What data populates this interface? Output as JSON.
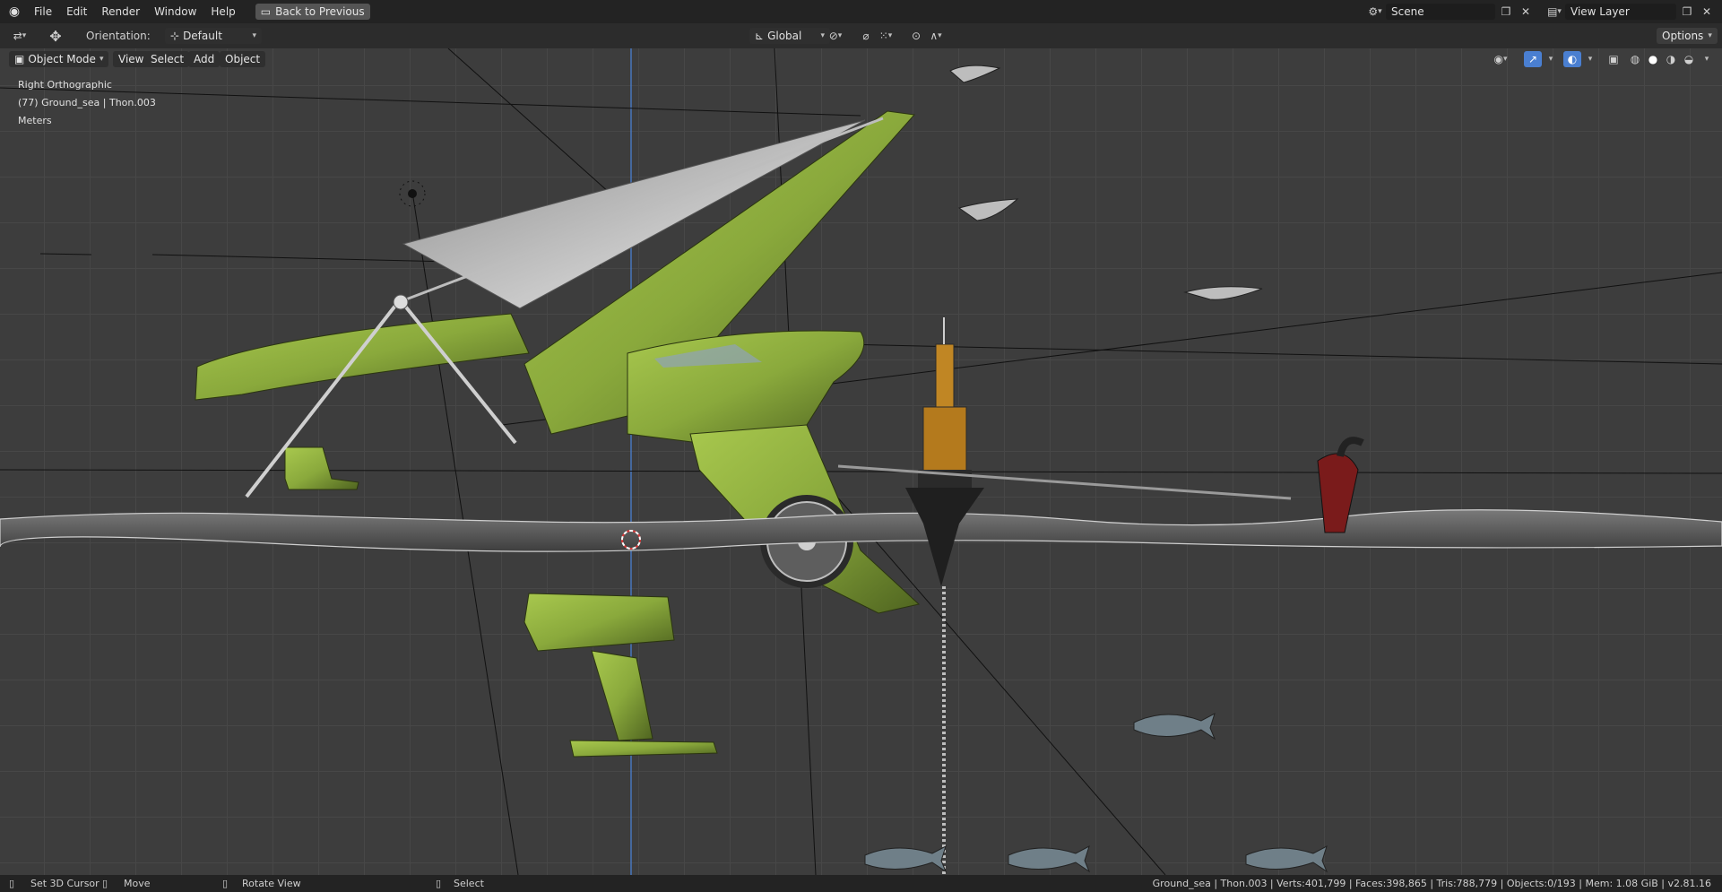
{
  "menubar": {
    "items": [
      "File",
      "Edit",
      "Render",
      "Window",
      "Help"
    ],
    "back_button": "Back to Previous",
    "scene_label": "Scene",
    "view_layer_label": "View Layer"
  },
  "tool_header": {
    "orientation_label": "Orientation:",
    "orientation_value": "Default",
    "transform_space": "Global",
    "options_label": "Options"
  },
  "viewport_header": {
    "mode": "Object Mode",
    "menus": [
      "View",
      "Select",
      "Add",
      "Object"
    ]
  },
  "viewport_info": {
    "view_name": "Right Orthographic",
    "object_info": "(77) Ground_sea | Thon.003",
    "units": "Meters"
  },
  "statusbar": {
    "left": [
      {
        "icon": "mouse-left-icon",
        "label": "Set 3D Cursor"
      },
      {
        "icon": "mouse-right-icon",
        "label": "Move"
      },
      {
        "icon": "mouse-middle-icon",
        "label": "Rotate View"
      },
      {
        "icon": "mouse-left-icon",
        "label": "Select"
      }
    ],
    "stats": "Ground_sea | Thon.003 | Verts:401,799 | Faces:398,865 | Tris:788,779 | Objects:0/193 | Mem: 1.08 GiB | v2.81.16"
  },
  "colors": {
    "hull_green": "#8fb040",
    "sail_gray": "#b9b9b9",
    "buoy_orange": "#b47a1d",
    "accent_blue": "#4a7fd1"
  }
}
